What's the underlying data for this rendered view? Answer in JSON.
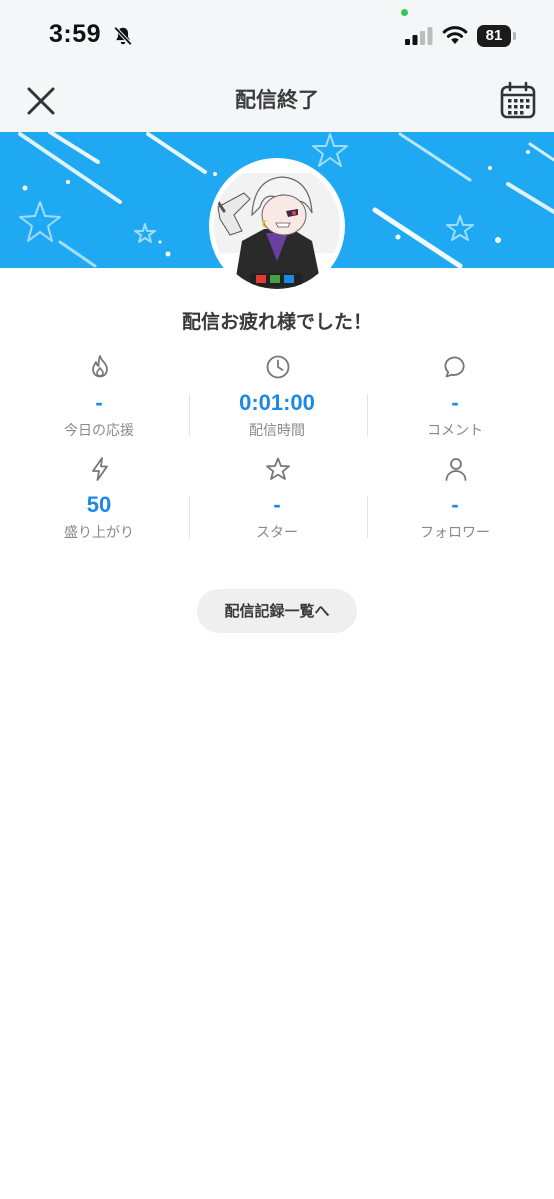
{
  "status_bar": {
    "time": "3:59",
    "battery_level": "81",
    "icons": [
      "bell-slash-icon",
      "signal-icon",
      "wifi-icon",
      "battery-icon"
    ]
  },
  "nav": {
    "title": "配信終了",
    "close_icon": "close-icon",
    "calendar_icon": "calendar-icon"
  },
  "banner": {
    "color": "#1fa9f2"
  },
  "greeting": "配信お疲れ様でした！",
  "stats": [
    {
      "icon": "flame-icon",
      "value": "-",
      "label": "今日の応援"
    },
    {
      "icon": "clock-icon",
      "value": "0:01:00",
      "label": "配信時間"
    },
    {
      "icon": "comment-icon",
      "value": "-",
      "label": "コメント"
    },
    {
      "icon": "lightning-icon",
      "value": "50",
      "label": "盛り上がり"
    },
    {
      "icon": "star-icon",
      "value": "-",
      "label": "スター"
    },
    {
      "icon": "person-icon",
      "value": "-",
      "label": "フォロワー"
    }
  ],
  "history_button": "配信記録一覧へ",
  "colors": {
    "accent": "#1e88e5",
    "label": "#8a8a8a",
    "background": "#f5f6f8"
  }
}
